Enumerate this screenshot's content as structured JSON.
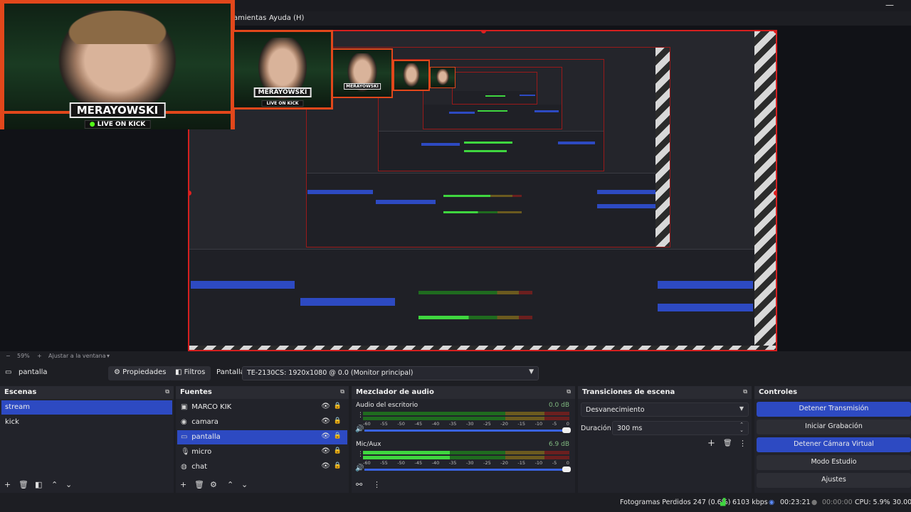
{
  "menu": {
    "items": [
      "amientas",
      "Ayuda (H)"
    ]
  },
  "overlay": {
    "streamer_name": "MERAYOWSKI",
    "live_text": "LIVE ON KICK"
  },
  "preview": {
    "zoom": "59%",
    "fit_label": "Ajustar a la ventana"
  },
  "source_bar": {
    "source_name": "pantalla",
    "properties_label": "Propiedades",
    "filters_label": "Filtros",
    "display_label": "Pantalla",
    "display_value": "TE-2130CS: 1920x1080 @ 0.0 (Monitor principal)"
  },
  "scenes": {
    "title": "Escenas",
    "items": [
      {
        "label": "stream",
        "selected": true
      },
      {
        "label": "kick",
        "selected": false
      }
    ]
  },
  "sources": {
    "title": "Fuentes",
    "items": [
      {
        "label": "MARCO KIK",
        "icon": "window-capture-icon"
      },
      {
        "label": "camara",
        "icon": "camera-icon"
      },
      {
        "label": "pantalla",
        "icon": "monitor-icon",
        "selected": true
      },
      {
        "label": "micro",
        "icon": "microphone-icon"
      },
      {
        "label": "chat",
        "icon": "browser-icon"
      }
    ]
  },
  "mixer": {
    "title": "Mezclador de audio",
    "channels": [
      {
        "name": "Audio del escritorio",
        "db": "0.0 dB",
        "level": 0
      },
      {
        "name": "Mic/Aux",
        "db": "6.9 dB",
        "level": 0.42
      }
    ],
    "ticks": [
      "-60",
      "-55",
      "-50",
      "-45",
      "-40",
      "-35",
      "-30",
      "-25",
      "-20",
      "-15",
      "-10",
      "-5",
      "0"
    ]
  },
  "transitions": {
    "title": "Transiciones de escena",
    "selected": "Desvanecimiento",
    "duration_label": "Duración",
    "duration_value": "300 ms"
  },
  "controls": {
    "title": "Controles",
    "buttons": [
      {
        "label": "Detener Transmisión",
        "active": true
      },
      {
        "label": "Iniciar Grabación",
        "active": false
      },
      {
        "label": "Detener Cámara Virtual",
        "active": true
      },
      {
        "label": "Modo Estudio",
        "active": false
      },
      {
        "label": "Ajustes",
        "active": false
      }
    ]
  },
  "status": {
    "dropped_frames": "Fotogramas Perdidos 247 (0.6%)",
    "bitrate": "6103 kbps",
    "stream_time": "00:23:21",
    "rec_time": "00:00:00",
    "cpu": "CPU: 5.9%",
    "fps": "30.00"
  },
  "colors": {
    "accent_blue": "#2d4ac2",
    "preview_border": "#d61f1f",
    "overlay_orange": "#e2471b",
    "kick_green": "#53fc18"
  }
}
